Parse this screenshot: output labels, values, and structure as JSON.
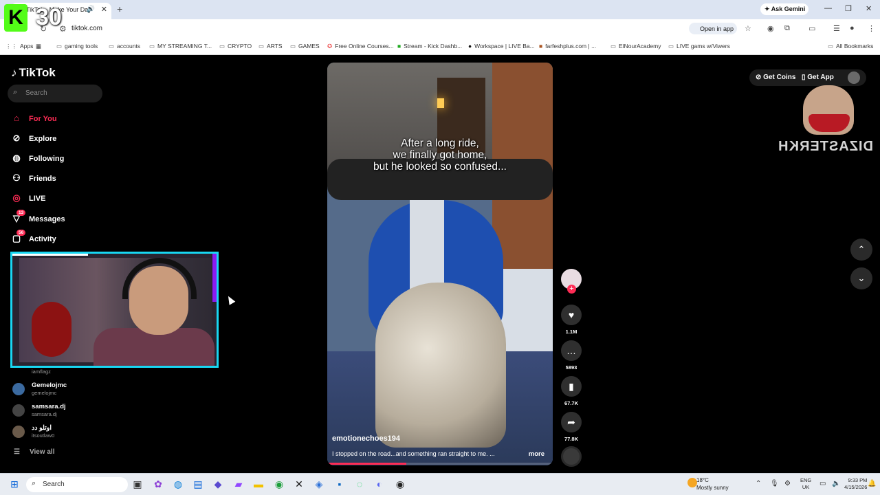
{
  "browser": {
    "tab_title": "TikTok - Make Your Day",
    "url": "tiktok.com",
    "ask_gemini": "Ask Gemini",
    "open_in_app": "Open in app",
    "bookmarks": [
      "Apps",
      "gaming tools",
      "accounts",
      "MY STREAMING T...",
      "CRYPTO",
      "ARTS",
      "GAMES",
      "Free Online Courses...",
      "Stream - Kick Dashb...",
      "Workspace | LIVE Ba...",
      "farfeshplus.com | ...",
      "ElNourAcademy",
      "LIVE gams w/Viwers"
    ],
    "all_bookmarks": "All Bookmarks"
  },
  "overlay": {
    "counter": "30"
  },
  "tiktok": {
    "logo": "TikTok",
    "search_placeholder": "Search",
    "nav": [
      {
        "label": "For You",
        "icon": "home-icon"
      },
      {
        "label": "Explore",
        "icon": "compass-icon"
      },
      {
        "label": "Following",
        "icon": "following-avatar-icon"
      },
      {
        "label": "Friends",
        "icon": "friends-icon"
      },
      {
        "label": "LIVE",
        "icon": "live-icon"
      },
      {
        "label": "Messages",
        "icon": "messages-icon",
        "badge": "13"
      },
      {
        "label": "Activity",
        "icon": "activity-icon",
        "badge": "56"
      }
    ],
    "following": [
      {
        "name": "",
        "username": "iamflagz"
      },
      {
        "name": "Gemelojmc",
        "username": "gemelojmc"
      },
      {
        "name": "samsara.dj",
        "username": "samsara.dj"
      },
      {
        "name": "اوتلو دد",
        "username": "itsoutlaw0"
      }
    ],
    "view_all": "View all",
    "get_coins": "Get Coins",
    "get_app": "Get App",
    "streamer_name": "DIZASTERKH"
  },
  "video": {
    "caption_lines": [
      "After a long ride,",
      "we finally got home,",
      "but he looked so confused..."
    ],
    "username": "emotionechoes194",
    "description": "I stopped on the road...and something ran straight to me. ...",
    "more": "more",
    "progress": 0.35,
    "likes": "1.1M",
    "comments": "5893",
    "saves": "67.7K",
    "shares": "77.8K"
  },
  "taskbar": {
    "search": "Search",
    "temperature": "18°C",
    "weather": "Mostly sunny",
    "lang_top": "ENG",
    "lang_bottom": "UK",
    "time": "9:33 PM",
    "date": "4/15/2026"
  }
}
